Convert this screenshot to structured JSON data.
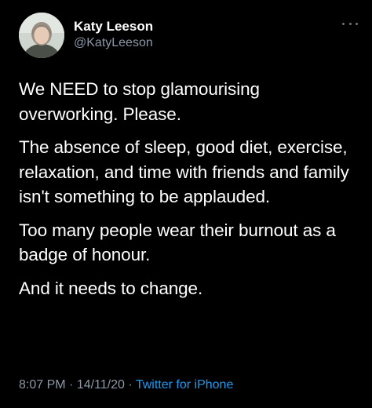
{
  "author": {
    "display_name": "Katy Leeson",
    "handle": "@KatyLeeson"
  },
  "tweet": {
    "paragraphs": [
      "We NEED to stop glamourising overworking. Please.",
      "The absence of sleep, good diet, exercise, relaxation, and time with friends and family isn't something to be applauded.",
      "Too many people wear their burnout as a badge of honour.",
      "And it needs to change."
    ]
  },
  "meta": {
    "time": "8:07 PM",
    "separator": " · ",
    "date": "14/11/20",
    "source": "Twitter for iPhone"
  },
  "icons": {
    "more": "more-horizontal-icon",
    "avatar": "profile-photo"
  },
  "colors": {
    "background": "#000000",
    "text": "#ffffff",
    "secondary": "#8b98a5",
    "link": "#1d9bf0"
  }
}
